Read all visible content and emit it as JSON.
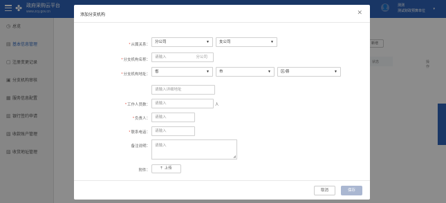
{
  "app": {
    "brand": "政府采购云平台",
    "brand_sub": "www.zcy.gov.cn",
    "user_name": "测测",
    "user_org": "测试财政预算单位"
  },
  "sidebar": {
    "items": [
      {
        "icon": "clock-icon",
        "label": "总览"
      },
      {
        "icon": "doc-icon",
        "label": "基本信息管理"
      },
      {
        "icon": "edit-icon",
        "label": "注册变更记录"
      },
      {
        "icon": "branch-icon",
        "label": "分支机构审核"
      },
      {
        "icon": "service-icon",
        "label": "服务信息配置"
      },
      {
        "icon": "bank-icon",
        "label": "银行签约申请"
      },
      {
        "icon": "account-icon",
        "label": "收款账户管理"
      },
      {
        "icon": "address-icon",
        "label": "收货地址管理"
      }
    ]
  },
  "background": {
    "new_button": "新增",
    "col_status": "状态",
    "col_action": "操作"
  },
  "modal": {
    "title": "添加分支机构",
    "fields": {
      "affiliation_label": "从属关系：",
      "affiliation_value1": "分公司",
      "affiliation_value2": "支公司",
      "name_label": "分支机构名称：",
      "name_placeholder": "请输入",
      "name_suffix": "分公司",
      "address_label": "分支机构地址：",
      "province_value": "省",
      "city_value": "市",
      "district_value": "区/县",
      "detail_placeholder": "请输入详细地址",
      "staff_label": "工作人员数：",
      "staff_placeholder": "请输入",
      "staff_unit": "人",
      "leader_label": "负责人：",
      "leader_placeholder": "请输入",
      "phone_label": "联系电话：",
      "phone_placeholder": "请输入",
      "remark_label": "备注说明：",
      "remark_placeholder": "请输入",
      "attachment_label": "附件：",
      "upload_label": "上传"
    },
    "cancel_label": "取消",
    "save_label": "保存"
  }
}
